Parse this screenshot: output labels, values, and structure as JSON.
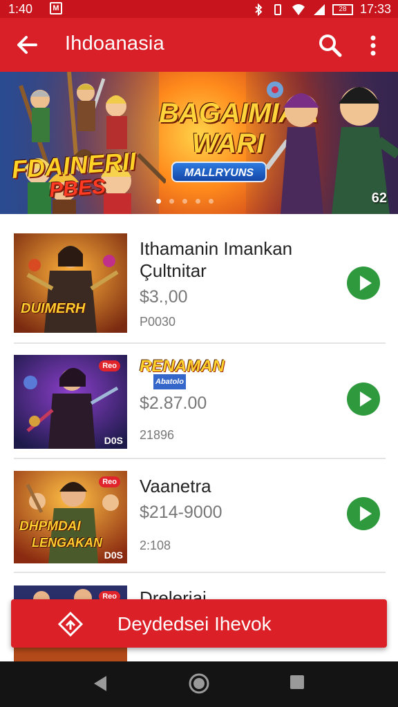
{
  "status_bar": {
    "time": "1:40",
    "clock": "17:33",
    "battery_text": "28"
  },
  "toolbar": {
    "title": "Ihdoanasia"
  },
  "banner": {
    "logo_line1": "FDAINERII",
    "logo_line2": "PBES",
    "headline": "BAGAIMIAA WARI",
    "pill_label": "MALLRYUNS",
    "page_counter": "62",
    "slide_count": 5,
    "active_slide": 0
  },
  "items": [
    {
      "name_line1": "Ithamanin Imankan",
      "name_line2": "Çultnitar",
      "price": "$3.,00",
      "sub": "P0030",
      "thumb_caption": "DUIMERH"
    },
    {
      "brand_logo": "RENAMAN",
      "brand_logo_sub": "Abatolo",
      "price": "$2.87.00",
      "sub": "21896",
      "thumb_tag": "D0S",
      "thumb_badge": "Reo"
    },
    {
      "name_line1": "Vaanetra",
      "price": "$214-9000",
      "sub": "2:108",
      "thumb_caption_1": "DHPMDAI",
      "thumb_caption_2": "LENGAKAN",
      "thumb_tag": "D0S",
      "thumb_badge": "Reo"
    },
    {
      "name_line1": "Dreleriai",
      "thumb_badge": "Reo"
    }
  ],
  "action_button": {
    "label": "Deydedsei Ihevok"
  },
  "colors": {
    "primary": "#d91f27",
    "status_bar": "#c8141c",
    "play": "#2e9a3d",
    "nav": "#141414"
  },
  "icons": [
    "back-arrow-icon",
    "search-icon",
    "more-vert-icon",
    "play-icon",
    "diamond-direction-icon",
    "nav-back-icon",
    "nav-home-icon",
    "nav-recents-icon"
  ]
}
